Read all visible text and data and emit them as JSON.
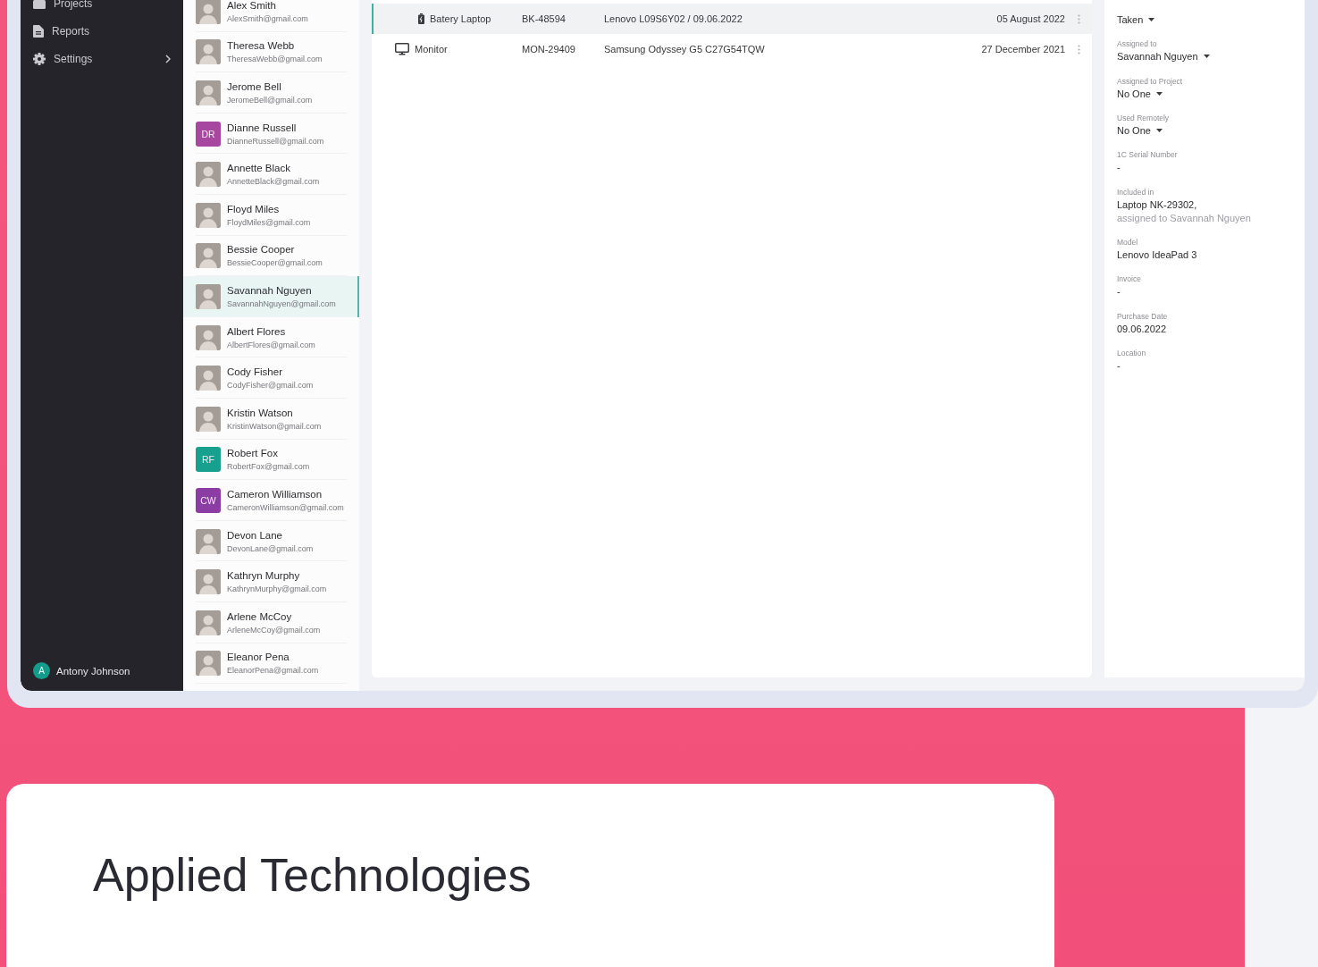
{
  "sidebar": {
    "items": [
      {
        "label": "Projects",
        "kind": "briefcase",
        "expandable": false
      },
      {
        "label": "Reports",
        "kind": "document",
        "expandable": false
      },
      {
        "label": "Settings",
        "kind": "gear",
        "expandable": true
      }
    ],
    "user": {
      "initial": "A",
      "name": "Antony Johnson"
    }
  },
  "people": [
    {
      "name": "Alex Smith",
      "email": "AlexSmith@gmail.com",
      "kind": "photo",
      "selected": false
    },
    {
      "name": "Theresa Webb",
      "email": "TheresaWebb@gmail.com",
      "kind": "photo",
      "selected": false
    },
    {
      "name": "Jerome Bell",
      "email": "JeromeBell@gmail.com",
      "kind": "photo",
      "selected": false
    },
    {
      "name": "Dianne Russell",
      "email": "DianneRussell@gmail.com",
      "kind": "initials",
      "initials": "DR",
      "color": "#a8479f",
      "selected": false
    },
    {
      "name": "Annette Black",
      "email": "AnnetteBlack@gmail.com",
      "kind": "photo",
      "selected": false
    },
    {
      "name": "Floyd Miles",
      "email": "FloydMiles@gmail.com",
      "kind": "photo",
      "selected": false
    },
    {
      "name": "Bessie Cooper",
      "email": "BessieCooper@gmail.com",
      "kind": "photo",
      "selected": false
    },
    {
      "name": "Savannah Nguyen",
      "email": "SavannahNguyen@gmail.com",
      "kind": "photo",
      "selected": true
    },
    {
      "name": "Albert Flores",
      "email": "AlbertFlores@gmail.com",
      "kind": "photo",
      "selected": false
    },
    {
      "name": "Cody Fisher",
      "email": "CodyFisher@gmail.com",
      "kind": "photo",
      "selected": false
    },
    {
      "name": "Kristin Watson",
      "email": "KristinWatson@gmail.com",
      "kind": "photo",
      "selected": false
    },
    {
      "name": "Robert Fox",
      "email": "RobertFox@gmail.com",
      "kind": "initials",
      "initials": "RF",
      "color": "#18a08e",
      "selected": false
    },
    {
      "name": "Cameron Williamson",
      "email": "CameronWilliamson@gmail.com",
      "kind": "initials",
      "initials": "CW",
      "color": "#8c3da3",
      "selected": false
    },
    {
      "name": "Devon Lane",
      "email": "DevonLane@gmail.com",
      "kind": "photo",
      "selected": false
    },
    {
      "name": "Kathryn Murphy",
      "email": "KathrynMurphy@gmail.com",
      "kind": "photo",
      "selected": false
    },
    {
      "name": "Arlene McCoy",
      "email": "ArleneMcCoy@gmail.com",
      "kind": "photo",
      "selected": false
    },
    {
      "name": "Eleanor Pena",
      "email": "EleanorPena@gmail.com",
      "kind": "photo",
      "selected": false
    }
  ],
  "devices": [
    {
      "kind": "battery",
      "name": "Batery Laptop",
      "code": "BK-48594",
      "description": "Lenovo L09S6Y02 / 09.06.2022",
      "date": "05 August 2022",
      "selected": true
    },
    {
      "kind": "monitor",
      "name": "Monitor",
      "code": "MON-29409",
      "description": "Samsung Odyssey G5 C27G54TQW",
      "date": "27 December 2021",
      "selected": false
    }
  ],
  "details": [
    {
      "kind": "dropdown",
      "value": "Taken"
    },
    {
      "kind": "dropdown",
      "label": "Assigned to",
      "value": "Savannah Nguyen"
    },
    {
      "kind": "dropdown",
      "label": "Assigned to Project",
      "value": "No One"
    },
    {
      "kind": "dropdown",
      "label": "Used Remotely",
      "value": "No One"
    },
    {
      "kind": "text",
      "label": "1C Serial Number",
      "value": "-"
    },
    {
      "kind": "text",
      "label": "Included in",
      "value": "Laptop NK-29302,",
      "note": "assigned to Savannah Nguyen"
    },
    {
      "kind": "text",
      "label": "Model",
      "value": "Lenovo IdeaPad 3"
    },
    {
      "kind": "text",
      "label": "Invoice",
      "value": "-"
    },
    {
      "kind": "text",
      "label": "Purchase Date",
      "value": "09.06.2022"
    },
    {
      "kind": "text",
      "label": "Location",
      "value": "-"
    }
  ],
  "section": {
    "title": "Applied Technologies"
  }
}
